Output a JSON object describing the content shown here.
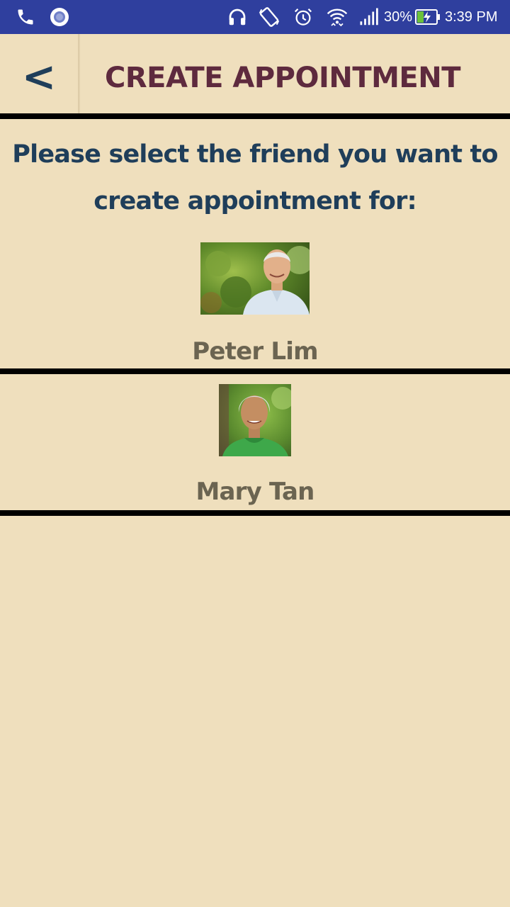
{
  "status_bar": {
    "icons_left": [
      "phone-icon",
      "record-icon"
    ],
    "icons_right": [
      "headphones-icon",
      "auto-rotate-icon",
      "alarm-icon",
      "wifi-icon",
      "signal-icon",
      "battery-charging-icon"
    ],
    "battery_percent": "30%",
    "time": "3:39 PM",
    "background_color": "#2f3f9e"
  },
  "header": {
    "back_label": "<",
    "title": "CREATE APPOINTMENT",
    "title_color": "#5e2a3e"
  },
  "prompt": {
    "line1": "Please select the friend you want to",
    "line2": "create appointment for:",
    "color": "#1f3e5a"
  },
  "friends": [
    {
      "name": "Peter Lim",
      "photo": "elderly-man-photo"
    },
    {
      "name": "Mary Tan",
      "photo": "elderly-woman-photo"
    }
  ],
  "colors": {
    "background": "#efdfbd",
    "divider": "#000000",
    "name_text": "#6b6451"
  }
}
